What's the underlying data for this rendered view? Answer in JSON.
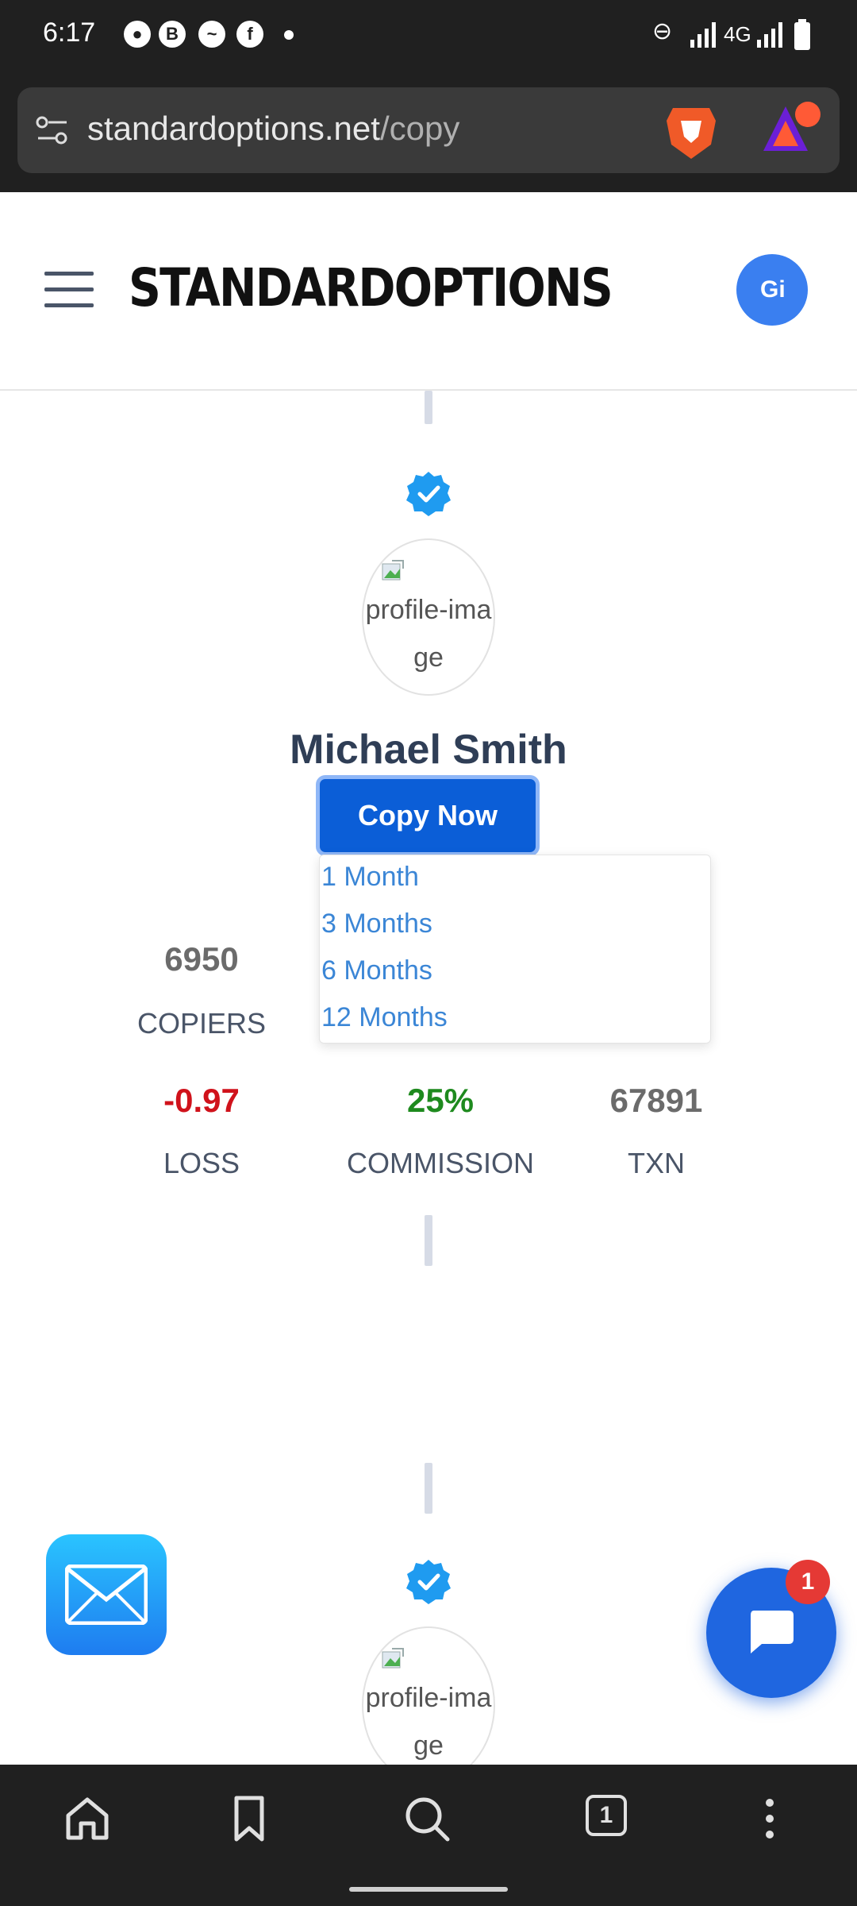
{
  "status_bar": {
    "time": "6:17",
    "network": "4G"
  },
  "browser": {
    "url_domain": "standardoptions.net",
    "url_path": "/copy",
    "tab_count": "1"
  },
  "site": {
    "brand": "STANDARDOPTIONS",
    "avatar_alt": "Gi"
  },
  "trader": {
    "image_alt": "profile-image",
    "name": "Michael Smith",
    "copy_button": "Copy Now",
    "durations": [
      "1 Month",
      "3 Months",
      "6 Months",
      "12 Months"
    ],
    "copiers": {
      "value": "6950",
      "label": "COPIERS"
    },
    "loss": {
      "value": "-0.97",
      "label": "LOSS"
    },
    "commission": {
      "value": "25%",
      "label": "COMMISSION"
    },
    "txn": {
      "value": "67891",
      "label": "TXN"
    }
  },
  "next_trader": {
    "image_alt": "profile-image"
  },
  "chat": {
    "badge_count": "1"
  },
  "colors": {
    "accent": "#0b5ed7",
    "loss": "#d0121b",
    "commission": "#1e8a1e",
    "link": "#3b86d6"
  }
}
